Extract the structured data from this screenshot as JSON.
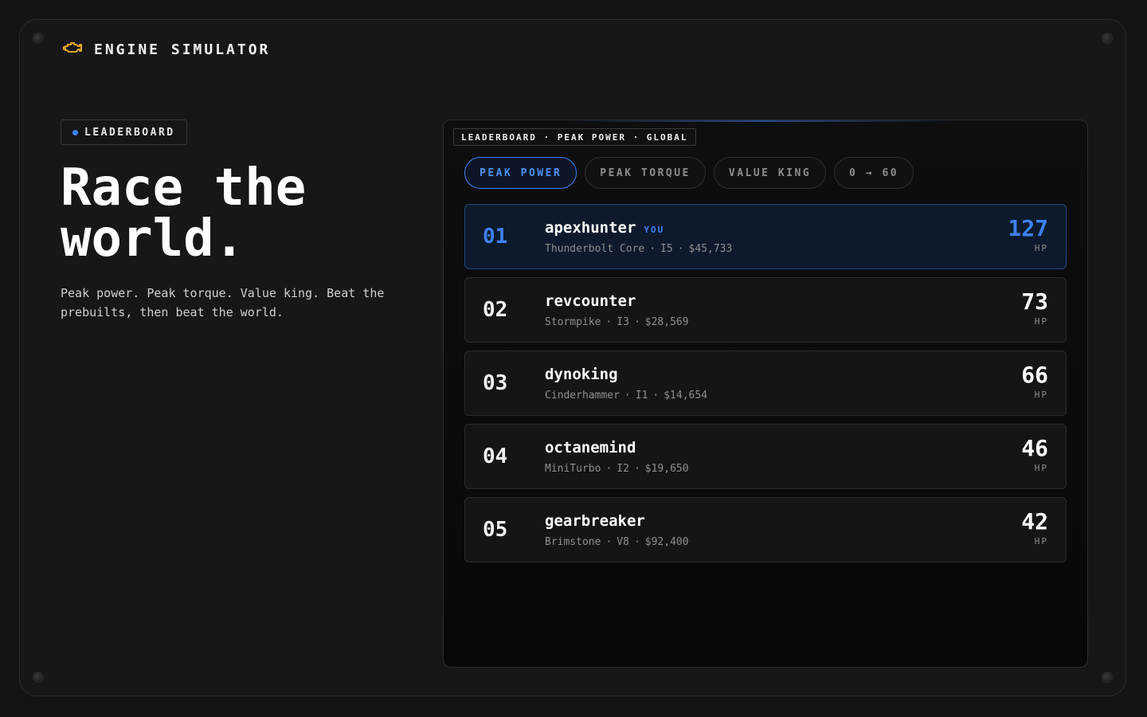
{
  "app": {
    "title": "ENGINE SIMULATOR",
    "icon": "engine-icon",
    "icon_color": "#e0a526"
  },
  "hero": {
    "badge": "LEADERBOARD",
    "headline_line1": "Race the",
    "headline_line2": "world.",
    "tagline": "Peak power. Peak torque. Value king. Beat the prebuilts, then beat the world."
  },
  "board": {
    "label": "LEADERBOARD · PEAK POWER · GLOBAL",
    "tabs": [
      {
        "label": "PEAK POWER",
        "active": true
      },
      {
        "label": "PEAK TORQUE",
        "active": false
      },
      {
        "label": "VALUE KING",
        "active": false
      },
      {
        "label": "0 → 60",
        "active": false
      }
    ],
    "rows": [
      {
        "rank": "01",
        "player": "apexhunter",
        "you_tag": "YOU",
        "engine": "Thunderbolt Core",
        "config": "I5",
        "price": "$45,733",
        "value": "127",
        "unit": "HP"
      },
      {
        "rank": "02",
        "player": "revcounter",
        "engine": "Stormpike",
        "config": "I3",
        "price": "$28,569",
        "value": "73",
        "unit": "HP"
      },
      {
        "rank": "03",
        "player": "dynoking",
        "engine": "Cinderhammer",
        "config": "I1",
        "price": "$14,654",
        "value": "66",
        "unit": "HP"
      },
      {
        "rank": "04",
        "player": "octanemind",
        "engine": "MiniTurbo",
        "config": "I2",
        "price": "$19,650",
        "value": "46",
        "unit": "HP"
      },
      {
        "rank": "05",
        "player": "gearbreaker",
        "engine": "Brimstone",
        "config": "V8",
        "price": "$92,400",
        "value": "42",
        "unit": "HP"
      }
    ]
  },
  "colors": {
    "accent": "#3b82f6",
    "background": "#141414"
  }
}
